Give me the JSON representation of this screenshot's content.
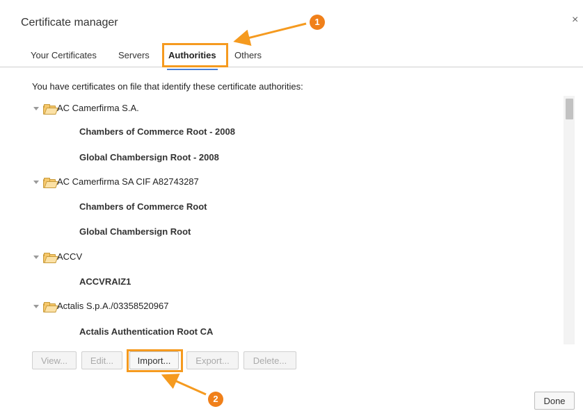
{
  "dialog": {
    "title": "Certificate manager",
    "close": "×"
  },
  "tabs": [
    {
      "label": "Your Certificates"
    },
    {
      "label": "Servers"
    },
    {
      "label": "Authorities",
      "active": true
    },
    {
      "label": "Others"
    }
  ],
  "intro": "You have certificates on file that identify these certificate authorities:",
  "tree": {
    "groups": [
      {
        "label": "AC Camerfirma S.A.",
        "items": [
          "Chambers of Commerce Root - 2008",
          "Global Chambersign Root - 2008"
        ]
      },
      {
        "label": "AC Camerfirma SA CIF A82743287",
        "items": [
          "Chambers of Commerce Root",
          "Global Chambersign Root"
        ]
      },
      {
        "label": "ACCV",
        "items": [
          "ACCVRAIZ1"
        ]
      },
      {
        "label": "Actalis S.p.A./03358520967",
        "items": [
          "Actalis Authentication Root CA"
        ]
      }
    ]
  },
  "buttons": {
    "view": "View...",
    "edit": "Edit...",
    "import": "Import...",
    "export": "Export...",
    "delete": "Delete...",
    "done": "Done"
  },
  "annotations": {
    "badge1": "1",
    "badge2": "2",
    "color": "#f59a1f"
  },
  "icons": {
    "folder": "folder-icon",
    "expand": "triangle-down-icon"
  }
}
